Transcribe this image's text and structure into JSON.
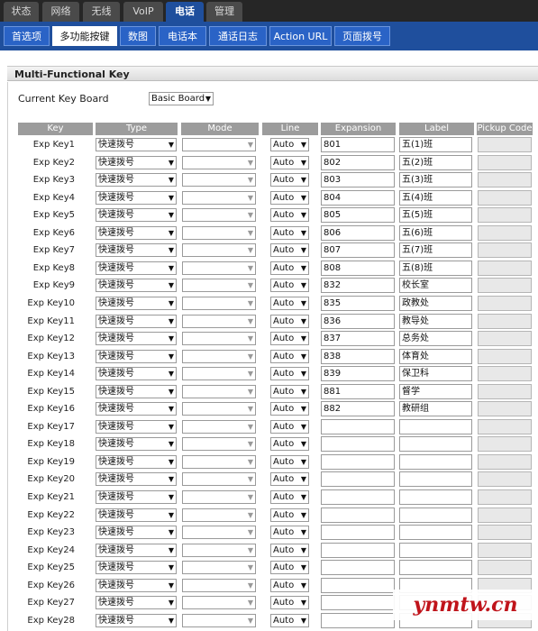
{
  "top_nav": [
    {
      "label": "状态",
      "active": false
    },
    {
      "label": "网络",
      "active": false
    },
    {
      "label": "无线",
      "active": false
    },
    {
      "label": "VoIP",
      "active": false
    },
    {
      "label": "电话",
      "active": true
    },
    {
      "label": "管理",
      "active": false
    }
  ],
  "sub_nav": [
    {
      "label": "首选项",
      "active": false
    },
    {
      "label": "多功能按键",
      "active": true
    },
    {
      "label": "数图",
      "active": false
    },
    {
      "label": "电话本",
      "active": false
    },
    {
      "label": "通话日志",
      "active": false
    },
    {
      "label": "Action URL",
      "active": false
    },
    {
      "label": "页面拨号",
      "active": false
    }
  ],
  "section_title": "Multi-Functional Key",
  "key_board": {
    "label": "Current Key Board",
    "value": "Basic Board"
  },
  "columns": [
    "Key",
    "Type",
    "Mode",
    "Line",
    "Expansion",
    "Label",
    "Pickup Code"
  ],
  "rows": [
    {
      "key": "Exp Key1",
      "type": "快速拨号",
      "mode": "",
      "line": "Auto",
      "expansion": "801",
      "label": "五(1)班",
      "pickup": ""
    },
    {
      "key": "Exp Key2",
      "type": "快速拨号",
      "mode": "",
      "line": "Auto",
      "expansion": "802",
      "label": "五(2)班",
      "pickup": ""
    },
    {
      "key": "Exp Key3",
      "type": "快速拨号",
      "mode": "",
      "line": "Auto",
      "expansion": "803",
      "label": "五(3)班",
      "pickup": ""
    },
    {
      "key": "Exp Key4",
      "type": "快速拨号",
      "mode": "",
      "line": "Auto",
      "expansion": "804",
      "label": "五(4)班",
      "pickup": ""
    },
    {
      "key": "Exp Key5",
      "type": "快速拨号",
      "mode": "",
      "line": "Auto",
      "expansion": "805",
      "label": "五(5)班",
      "pickup": ""
    },
    {
      "key": "Exp Key6",
      "type": "快速拨号",
      "mode": "",
      "line": "Auto",
      "expansion": "806",
      "label": "五(6)班",
      "pickup": ""
    },
    {
      "key": "Exp Key7",
      "type": "快速拨号",
      "mode": "",
      "line": "Auto",
      "expansion": "807",
      "label": "五(7)班",
      "pickup": ""
    },
    {
      "key": "Exp Key8",
      "type": "快速拨号",
      "mode": "",
      "line": "Auto",
      "expansion": "808",
      "label": "五(8)班",
      "pickup": ""
    },
    {
      "key": "Exp Key9",
      "type": "快速拨号",
      "mode": "",
      "line": "Auto",
      "expansion": "832",
      "label": "校长室",
      "pickup": ""
    },
    {
      "key": "Exp Key10",
      "type": "快速拨号",
      "mode": "",
      "line": "Auto",
      "expansion": "835",
      "label": "政教处",
      "pickup": ""
    },
    {
      "key": "Exp Key11",
      "type": "快速拨号",
      "mode": "",
      "line": "Auto",
      "expansion": "836",
      "label": "教导处",
      "pickup": ""
    },
    {
      "key": "Exp Key12",
      "type": "快速拨号",
      "mode": "",
      "line": "Auto",
      "expansion": "837",
      "label": "总务处",
      "pickup": ""
    },
    {
      "key": "Exp Key13",
      "type": "快速拨号",
      "mode": "",
      "line": "Auto",
      "expansion": "838",
      "label": "体育处",
      "pickup": ""
    },
    {
      "key": "Exp Key14",
      "type": "快速拨号",
      "mode": "",
      "line": "Auto",
      "expansion": "839",
      "label": "保卫科",
      "pickup": ""
    },
    {
      "key": "Exp Key15",
      "type": "快速拨号",
      "mode": "",
      "line": "Auto",
      "expansion": "881",
      "label": "督学",
      "pickup": ""
    },
    {
      "key": "Exp Key16",
      "type": "快速拨号",
      "mode": "",
      "line": "Auto",
      "expansion": "882",
      "label": "教研组",
      "pickup": ""
    },
    {
      "key": "Exp Key17",
      "type": "快速拨号",
      "mode": "",
      "line": "Auto",
      "expansion": "",
      "label": "",
      "pickup": ""
    },
    {
      "key": "Exp Key18",
      "type": "快速拨号",
      "mode": "",
      "line": "Auto",
      "expansion": "",
      "label": "",
      "pickup": ""
    },
    {
      "key": "Exp Key19",
      "type": "快速拨号",
      "mode": "",
      "line": "Auto",
      "expansion": "",
      "label": "",
      "pickup": ""
    },
    {
      "key": "Exp Key20",
      "type": "快速拨号",
      "mode": "",
      "line": "Auto",
      "expansion": "",
      "label": "",
      "pickup": ""
    },
    {
      "key": "Exp Key21",
      "type": "快速拨号",
      "mode": "",
      "line": "Auto",
      "expansion": "",
      "label": "",
      "pickup": ""
    },
    {
      "key": "Exp Key22",
      "type": "快速拨号",
      "mode": "",
      "line": "Auto",
      "expansion": "",
      "label": "",
      "pickup": ""
    },
    {
      "key": "Exp Key23",
      "type": "快速拨号",
      "mode": "",
      "line": "Auto",
      "expansion": "",
      "label": "",
      "pickup": ""
    },
    {
      "key": "Exp Key24",
      "type": "快速拨号",
      "mode": "",
      "line": "Auto",
      "expansion": "",
      "label": "",
      "pickup": ""
    },
    {
      "key": "Exp Key25",
      "type": "快速拨号",
      "mode": "",
      "line": "Auto",
      "expansion": "",
      "label": "",
      "pickup": ""
    },
    {
      "key": "Exp Key26",
      "type": "快速拨号",
      "mode": "",
      "line": "Auto",
      "expansion": "",
      "label": "",
      "pickup": ""
    },
    {
      "key": "Exp Key27",
      "type": "快速拨号",
      "mode": "",
      "line": "Auto",
      "expansion": "",
      "label": "",
      "pickup": ""
    },
    {
      "key": "Exp Key28",
      "type": "快速拨号",
      "mode": "",
      "line": "Auto",
      "expansion": "",
      "label": "",
      "pickup": ""
    }
  ],
  "watermark": "ynmtw.cn",
  "colors": {
    "nav_dark": "#262626",
    "nav_blue": "#1f4f9d",
    "header_gray": "#9c9c9c",
    "watermark_red": "#c0141b"
  }
}
